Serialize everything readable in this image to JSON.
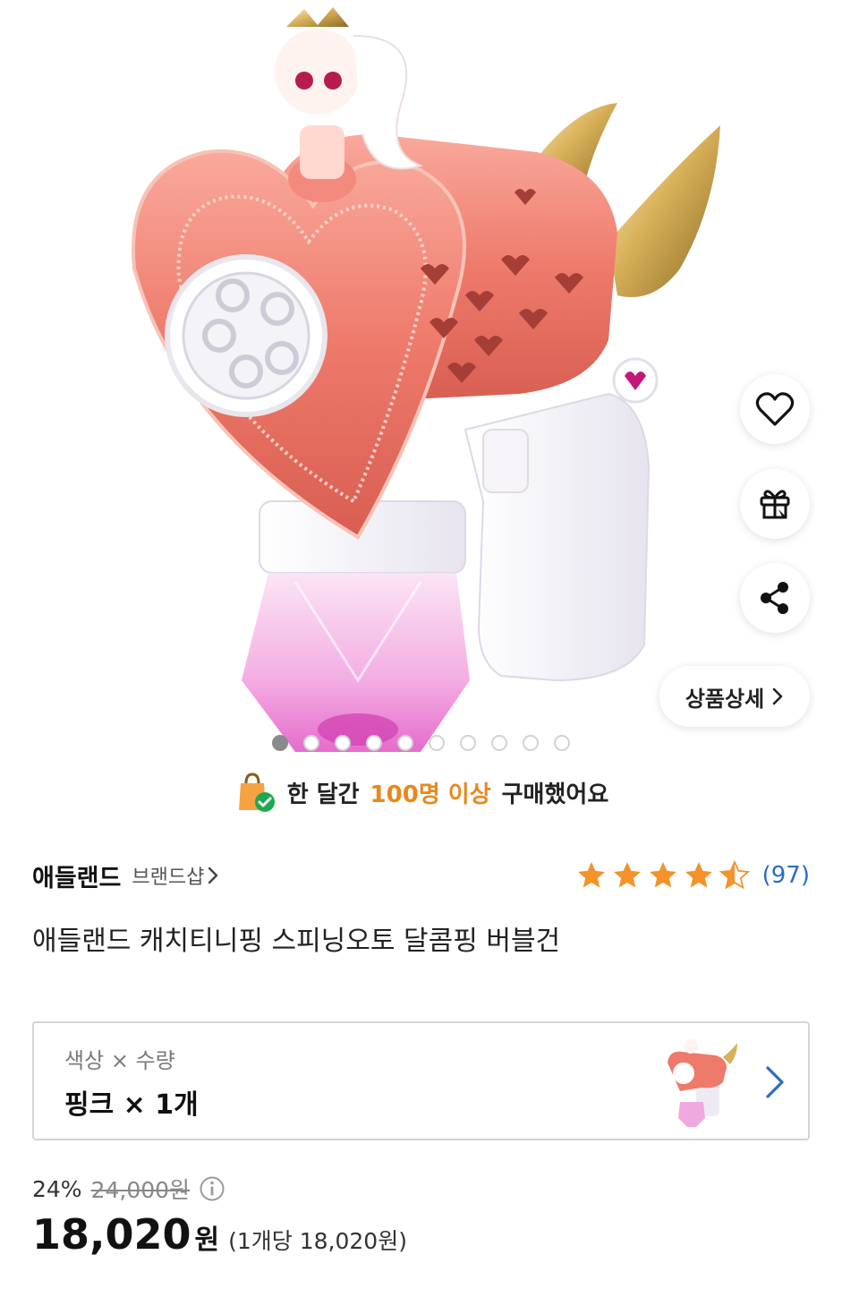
{
  "hero": {
    "dots_total": 10,
    "dots_active_index": 0,
    "detail_button_label": "상품상세",
    "icons": [
      "heart-icon",
      "gift-icon",
      "share-icon",
      "chevron-right-icon"
    ]
  },
  "purchase_banner": {
    "prefix": "한 달간",
    "highlight": "100명 이상",
    "suffix": "구매했어요",
    "highlight_color": "#e8881c"
  },
  "brand": {
    "name": "애들랜드",
    "shop_link": "브랜드샵"
  },
  "rating": {
    "stars": 4.5,
    "count_text": "(97)",
    "star_color": "#f5922a"
  },
  "product": {
    "title": "애들랜드 캐치티니핑 스피닝오토 달콤핑 버블건"
  },
  "option": {
    "label_color": "색상",
    "label_sep": "×",
    "label_qty": "수량",
    "value_color": "핑크",
    "value_sep": "×",
    "value_qty": "1개"
  },
  "price": {
    "discount_rate": "24%",
    "original": "24,000원",
    "sale_amount": "18,020",
    "sale_unit": "원",
    "per_unit": "(1개당 18,020원)"
  },
  "colors": {
    "accent_blue": "#2a6cc5",
    "coral": "#f07a6c"
  }
}
